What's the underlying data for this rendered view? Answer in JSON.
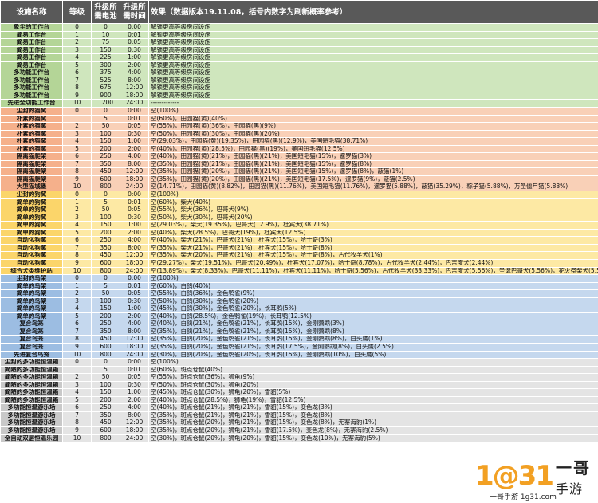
{
  "header": {
    "name": "设施名称",
    "level": "等级",
    "battery": "升级所需电池",
    "time": "升级所需时间",
    "effect": "效果（数据版本19.11.08，括号内数字为刷新概率参考）"
  },
  "groups": [
    {
      "color": "g1",
      "rows": [
        [
          "象尘的工作台",
          "0",
          "0",
          "0:00",
          "解锁更高等级房间设施"
        ],
        [
          "简易工作台",
          "1",
          "10",
          "0:01",
          "解锁更高等级房间设施"
        ],
        [
          "简易工作台",
          "2",
          "75",
          "0:05",
          "解锁更高等级房间设施"
        ],
        [
          "简易工作台",
          "3",
          "150",
          "0:30",
          "解锁更高等级房间设施"
        ],
        [
          "简易工作台",
          "4",
          "225",
          "1:00",
          "解锁更高等级房间设施"
        ],
        [
          "简易工作台",
          "5",
          "300",
          "2:00",
          "解锁更高等级房间设施"
        ],
        [
          "多功能工作台",
          "6",
          "375",
          "4:00",
          "解锁更高等级房间设施"
        ],
        [
          "多功能工作台",
          "7",
          "525",
          "8:00",
          "解锁更高等级房间设施"
        ],
        [
          "多功能工作台",
          "8",
          "675",
          "12:00",
          "解锁更高等级房间设施"
        ],
        [
          "多功能工作台",
          "9",
          "900",
          "18:00",
          "解锁更高等级房间设施"
        ],
        [
          "先进全功能工作台",
          "10",
          "1200",
          "24:00",
          "-------------"
        ]
      ]
    },
    {
      "color": "g2",
      "rows": [
        [
          "尘封的猫窝",
          "0",
          "0",
          "0:00",
          "空(100%)"
        ],
        [
          "朴素的猫窝",
          "1",
          "5",
          "0:01",
          "空(60%)，田园猫(黄)(40%)"
        ],
        [
          "朴素的猫窝",
          "2",
          "50",
          "0:05",
          "空(55%)，田园猫(黄)(36%)，田园猫(黑)(9%)"
        ],
        [
          "朴素的猫窝",
          "3",
          "100",
          "0:30",
          "空(50%)，田园猫(黄)(30%)，田园猫(黑)(20%)"
        ],
        [
          "朴素的猫窝",
          "4",
          "150",
          "1:00",
          "空(29.03%)，田园猫(黄)(19.35%)，田园猫(黑)(12.9%)，美国短毛猫(38.71%)"
        ],
        [
          "朴素的猫窝",
          "5",
          "200",
          "2:00",
          "空(40%)，田园猫(黄)(28.5%)，田园猫(黑)(19%)，美国短毛猫(12.5%)"
        ],
        [
          "隔离猫爬架",
          "6",
          "250",
          "4:00",
          "空(40%)，田园猫(黄)(21%)，田园猫(黑)(21%)，美国短毛猫(15%)，暹罗猫(3%)"
        ],
        [
          "隔离猫爬架",
          "7",
          "350",
          "8:00",
          "空(35%)，田园猫(黄)(21%)，田园猫(黑)(21%)，美国短毛猫(15%)，暹罗猫(8%)"
        ],
        [
          "隔离猫爬架",
          "8",
          "450",
          "12:00",
          "空(35%)，田园猫(黄)(20%)，田园猫(黑)(21%)，美国短毛猫(15%)，暹罗猫(8%)，蔽猫(1%)"
        ],
        [
          "隔离猫爬架",
          "9",
          "600",
          "18:00",
          "空(35%)，田园猫(黄)(20%)，田园猫(黑)(21%)，美国短毛猫(17.5%)，暹罗猫(9%)，蔽猫(2.5%)"
        ],
        [
          "大型猫城堡",
          "10",
          "800",
          "24:00",
          "空(14.71%)，田园猫(黄)(8.82%)，田园猫(黑)(11.76%)，美国短毛猫(11.76%)，暹罗猫(5.88%)，蔽猫(35.29%)，粽子猫(5.88%)，万圣僵尸猫(5.88%)"
        ]
      ]
    },
    {
      "color": "g3",
      "rows": [
        [
          "尘封的狗窝",
          "0",
          "0",
          "0:00",
          "空(100%)"
        ],
        [
          "简单的狗窝",
          "1",
          "5",
          "0:01",
          "空(60%)，柴犬(40%)"
        ],
        [
          "简单的狗窝",
          "2",
          "50",
          "0:05",
          "空(55%)，柴犬(36%)，巴哥犬(9%)"
        ],
        [
          "简单的狗窝",
          "3",
          "100",
          "0:30",
          "空(50%)，柴犬(30%)，巴哥犬(20%)"
        ],
        [
          "简单的狗窝",
          "4",
          "150",
          "1:00",
          "空(29.03%)，柴犬(19.35%)，巴哥犬(12.9%)，杜宾犬(38.71%)"
        ],
        [
          "简单的狗窝",
          "5",
          "200",
          "2:00",
          "空(40%)，柴犬(28.5%)，巴哥犬(19%)，杜宾犬(12.5%)"
        ],
        [
          "自动化狗窝",
          "6",
          "250",
          "4:00",
          "空(40%)，柴犬(21%)，巴哥犬(21%)，杜宾犬(15%)，哈士奇(3%)"
        ],
        [
          "自动化狗窝",
          "7",
          "350",
          "8:00",
          "空(35%)，柴犬(21%)，巴哥犬(21%)，杜宾犬(15%)，哈士奇(8%)"
        ],
        [
          "自动化狗窝",
          "8",
          "450",
          "12:00",
          "空(35%)，柴犬(20%)，巴哥犬(21%)，杜宾犬(15%)，哈士奇(8%)，古代牧羊犬(1%)"
        ],
        [
          "自动化狗窝",
          "9",
          "600",
          "18:00",
          "空(29.27%)，柴犬(19.51%)，巴哥犬(20.49%)，杜宾犬(17.07%)，哈士奇(8.78%)，古代牧羊犬(2.44%)，巴吉度犬(2.44%)"
        ],
        [
          "综合犬类维护站",
          "10",
          "800",
          "24:00",
          "空(13.89%)，柴犬(8.33%)，巴哥犬(11.11%)，杜宾犬(11.11%)，哈士奇(5.56%)，古代牧羊犬(33.33%)，巴吉度犬(5.56%)，圣诞巴哥犬(5.56%)，花火祭柴犬(5.56%)"
        ]
      ]
    },
    {
      "color": "g4",
      "rows": [
        [
          "尘封的鸟架",
          "0",
          "0",
          "0:00",
          "空(100%)"
        ],
        [
          "简单的鸟架",
          "1",
          "5",
          "0:01",
          "空(60%)，白鸽(40%)"
        ],
        [
          "简单的鸟架",
          "2",
          "50",
          "0:05",
          "空(55%)，白鸽(36%)，金色鸮雀(9%)"
        ],
        [
          "简单的鸟架",
          "3",
          "100",
          "0:30",
          "空(50%)，白鸽(30%)，金色鸮雀(20%)"
        ],
        [
          "简单的鸟架",
          "4",
          "150",
          "1:00",
          "空(45%)，白鸽(30%)，金色鸮雀(20%)，长耳鸮(5%)"
        ],
        [
          "简单的鸟架",
          "5",
          "200",
          "2:00",
          "空(40%)，白鸽(28.5%)，金色鸮雀(19%)，长耳鸮(12.5%)"
        ],
        [
          "复合鸟笼",
          "6",
          "250",
          "4:00",
          "空(40%)，白鸽(21%)，金色鸮雀(21%)，长耳鸮(15%)，金刚鹦鹉(3%)"
        ],
        [
          "复合鸟笼",
          "7",
          "350",
          "8:00",
          "空(35%)，白鸽(21%)，金色鸮雀(21%)，长耳鸮(15%)，金刚鹦鹉(8%)"
        ],
        [
          "复合鸟笼",
          "8",
          "450",
          "12:00",
          "空(35%)，白鸽(20%)，金色鸮雀(21%)，长耳鸮(15%)，金刚鹦鹉(8%)，白头鹰(1%)"
        ],
        [
          "复合鸟笼",
          "9",
          "600",
          "18:00",
          "空(35%)，白鸽(20%)，金色鸮雀(21%)，长耳鸮(17.5%)，金刚鹦鹉(8%)，白头鹰(2.5%)"
        ],
        [
          "先进复合鸟笼",
          "10",
          "800",
          "24:00",
          "空(30%)，白鸽(20%)，金色鸮雀(20%)，长耳鸮(15%)，金刚鹦鹉(10%)，白头鹰(5%)"
        ]
      ]
    },
    {
      "color": "g5",
      "rows": [
        [
          "尘封的多功能恒温箱",
          "0",
          "0",
          "0:00",
          "空(100%)"
        ],
        [
          "简陋的多功能恒温箱",
          "1",
          "5",
          "0:01",
          "空(60%)，斑点仓鼠(40%)"
        ],
        [
          "简陋的多功能恒温箱",
          "2",
          "50",
          "0:05",
          "空(55%)，斑点仓鼠(36%)，狮龟(9%)"
        ],
        [
          "简陋的多功能恒温箱",
          "3",
          "100",
          "0:30",
          "空(50%)，斑点仓鼠(30%)，狮龟(20%)"
        ],
        [
          "简陋的多功能恒温箱",
          "4",
          "150",
          "1:00",
          "空(45%)，斑点仓鼠(30%)，狮龟(20%)，雪貂(5%)"
        ],
        [
          "简陋的多功能恒温箱",
          "5",
          "200",
          "2:00",
          "空(40%)，斑点仓鼠(28.5%)，狮龟(19%)，雪貂(12.5%)"
        ],
        [
          "多功能恒温游乐场",
          "6",
          "250",
          "4:00",
          "空(40%)，斑点仓鼠(21%)，狮龟(21%)，雪貂(15%)，变色龙(3%)"
        ],
        [
          "多功能恒温游乐场",
          "7",
          "350",
          "8:00",
          "空(35%)，斑点仓鼠(21%)，狮龟(21%)，雪貂(15%)，变色龙(8%)"
        ],
        [
          "多功能恒温游乐场",
          "8",
          "450",
          "12:00",
          "空(35%)，斑点仓鼠(20%)，狮龟(21%)，雪貂(15%)，变色龙(8%)，无寨海豹(1%)"
        ],
        [
          "多功能恒温游乐场",
          "9",
          "600",
          "18:00",
          "空(35%)，斑点仓鼠(20%)，狮龟(21%)，雪貂(17.5%)，变色龙(8%)，无寨海豹(2.5%)"
        ],
        [
          "全自动双层恒温乐园",
          "10",
          "800",
          "24:00",
          "空(30%)，斑点仓鼠(20%)，狮龟(20%)，雪貂(15%)，变色龙(10%)，无寨海豹(5%)"
        ]
      ]
    }
  ],
  "watermark": {
    "mark": "1@31",
    "line1": "一哥",
    "line2": "手游",
    "url": "一哥手游 1g31.com"
  }
}
